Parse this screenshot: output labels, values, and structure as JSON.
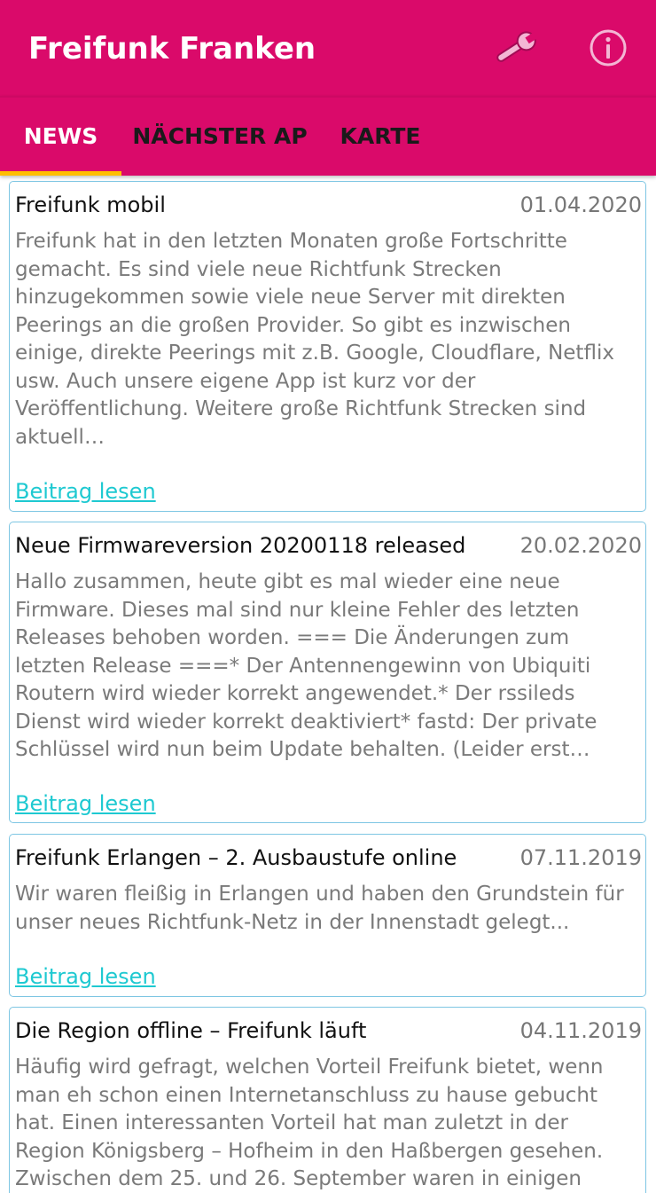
{
  "app": {
    "title": "Freifunk Franken"
  },
  "toolbar": {
    "actions": [
      {
        "icon": "wrench-icon",
        "label": "Einstellungen"
      },
      {
        "icon": "info-icon",
        "label": "Info"
      }
    ]
  },
  "tabs": [
    {
      "label": "NEWS",
      "active": true
    },
    {
      "label": "NÄCHSTER AP",
      "active": false
    },
    {
      "label": "KARTE",
      "active": false
    }
  ],
  "colors": {
    "primary": "#da0a6a",
    "tab_indicator": "#ffbe00",
    "card_border": "#7ec6e3",
    "link": "#1ec9d1",
    "text_muted": "#7a7a7a"
  },
  "news": [
    {
      "title": "Freifunk mobil",
      "date": "01.04.2020",
      "excerpt": "Freifunk hat in den letzten Monaten große Fortschritte gemacht. Es sind viele neue Richtfunk Strecken hinzugekommen sowie viele neue Server mit direkten Peerings an die großen Provider. So gibt es inzwischen einige, direkte Peerings mit z.B. Google, Cloudflare, Netflix usw. Auch unsere eigene App ist kurz vor der Veröffentlichung. Weitere große Richtfunk Strecken sind aktuell…",
      "link": "Beitrag lesen"
    },
    {
      "title": "Neue Firmwareversion 20200118 released",
      "date": "20.02.2020",
      "excerpt": "Hallo zusammen, heute gibt es mal wieder eine neue Firmware. Dieses mal sind nur kleine Fehler des letzten Releases behoben worden. === Die Änderungen zum letzten Release ===* Der Antennengewinn von Ubiquiti Routern wird wieder korrekt angewendet.* Der rssileds Dienst wird wieder korrekt deaktiviert* fastd: Der private Schlüssel wird nun beim Update behalten. (Leider erst…",
      "link": "Beitrag lesen"
    },
    {
      "title": "Freifunk Erlangen – 2. Ausbaustufe online",
      "date": "07.11.2019",
      "excerpt": "Wir waren fleißig in Erlangen und haben den Grundstein für unser neues Richtfunk-Netz in der Innenstadt gelegt...",
      "link": "Beitrag lesen"
    },
    {
      "title": "Die Region offline – Freifunk läuft",
      "date": "04.11.2019",
      "excerpt": "Häufig wird gefragt, welchen Vorteil Freifunk bietet, wenn man eh schon einen Internetanschluss zu hause gebucht hat. Einen interessanten Vorteil hat man zuletzt in der Region Königsberg – Hofheim in den Haßbergen gesehen. Zwischen dem 25. und 26. September waren in einigen",
      "link": ""
    }
  ]
}
